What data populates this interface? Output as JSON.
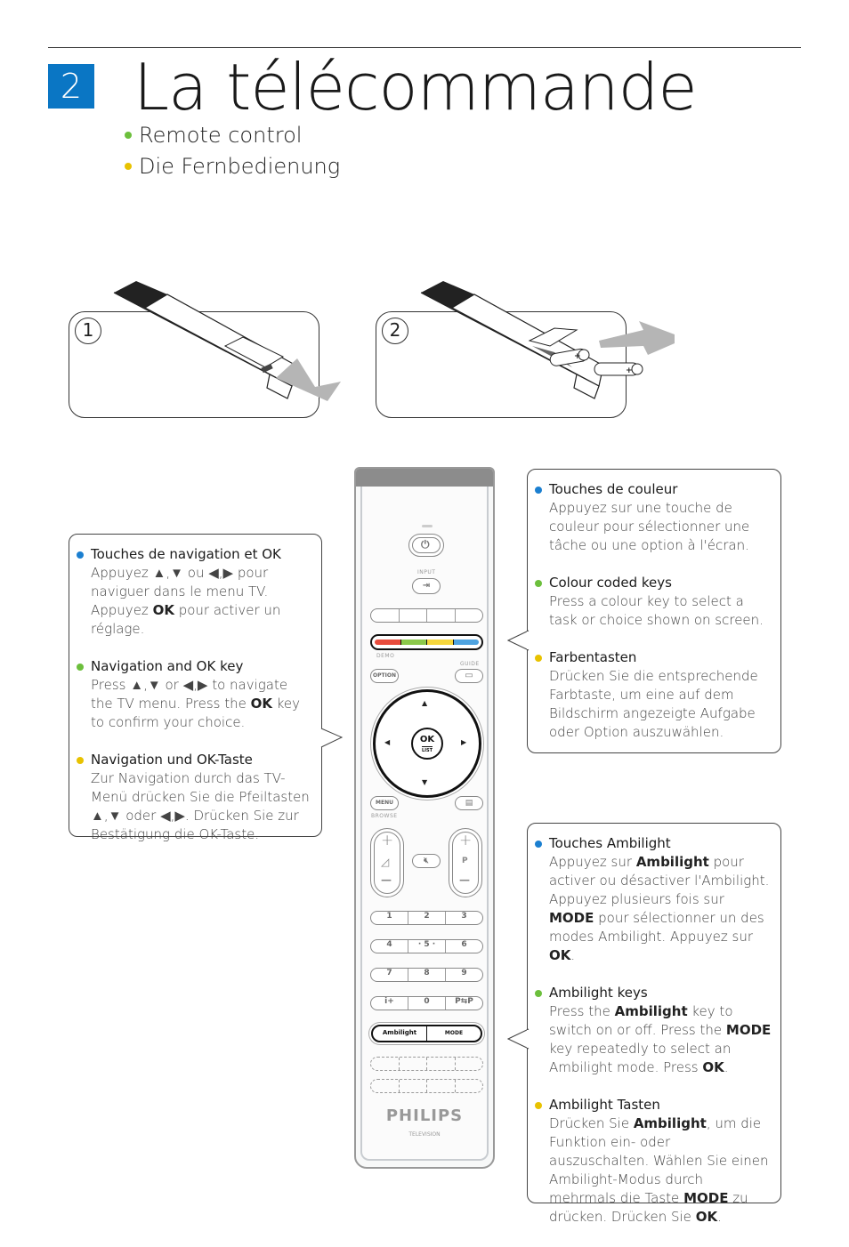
{
  "header": {
    "chapter_number": "2",
    "title": "La télécommande",
    "subtitles": [
      {
        "text": "Remote control",
        "bullet_color": "#6cbf3c"
      },
      {
        "text": "Die Fernbedienung",
        "bullet_color": "#e8c200"
      }
    ]
  },
  "battery_steps": [
    {
      "number": "1",
      "icon": "remote-cover-open-illustration"
    },
    {
      "number": "2",
      "icon": "insert-batteries-illustration"
    }
  ],
  "colors": {
    "accent_blue": "#0a76c4",
    "bullet_blue": "#1b7fd0",
    "bullet_green": "#6cbf3c",
    "bullet_yellow": "#e8c200",
    "key_red": "#e84c3d",
    "key_green": "#8cc84b",
    "key_yellow": "#f5d63d",
    "key_blue": "#4ea3e0"
  },
  "callouts": {
    "navigation": [
      {
        "bullet": "blue",
        "title": "Touches de navigation et OK",
        "body": "Appuyez ▲,▼ ou ◀,▶ pour naviguer dans le menu TV.  Appuyez OK pour activer un réglage."
      },
      {
        "bullet": "green",
        "title": "Navigation and OK key",
        "body": "Press ▲,▼ or ◀,▶ to navigate the TV menu. Press the OK key to confirm your choice."
      },
      {
        "bullet": "yellow",
        "title": "Navigation und OK-Taste",
        "body": "Zur Navigation durch das TV-Menü drücken Sie die Pfeiltasten ▲,▼ oder ◀,▶. Drücken Sie zur Bestätigung die OK-Taste."
      }
    ],
    "colour_keys": [
      {
        "bullet": "blue",
        "title": "Touches de couleur",
        "body": "Appuyez sur une touche de couleur pour sélectionner une tâche ou une option à l'écran."
      },
      {
        "bullet": "green",
        "title": "Colour coded keys",
        "body": "Press a colour key to select a task or choice shown on screen."
      },
      {
        "bullet": "yellow",
        "title": "Farbentasten",
        "body": "Drücken Sie die entsprechende Farbtaste, um eine auf dem Bildschirm angezeigte Aufgabe oder Option auszuwählen."
      }
    ],
    "ambilight": [
      {
        "bullet": "blue",
        "title": "Touches Ambilight",
        "body": "Appuyez sur Ambilight pour activer ou désactiver l'Ambilight. Appuyez plusieurs fois sur MODE pour sélectionner un des modes Ambilight. Appuyez sur OK."
      },
      {
        "bullet": "green",
        "title": "Ambilight keys",
        "body": "Press the Ambilight key to switch on or off. Press the MODE key repeatedly to select an Ambilight mode. Press OK."
      },
      {
        "bullet": "yellow",
        "title": "Ambilight Tasten",
        "body": "Drücken Sie Ambilight, um die Funktion ein- oder auszuschalten. Wählen Sie einen Ambilight-Modus durch mehrmals die Taste MODE zu drücken. Drücken Sie OK."
      }
    ]
  },
  "remote": {
    "input_label": "INPUT",
    "demo_label": "DEMO",
    "guide_label": "GUIDE",
    "option_label": "OPTION",
    "ok_label": "OK",
    "list_label": "LIST",
    "menu_label": "MENU",
    "browse_label": "BROWSE",
    "plus": "+",
    "minus": "—",
    "p_label": "P",
    "numpad": [
      [
        "1",
        "2",
        "3"
      ],
      [
        "4",
        "· 5 ·",
        "6"
      ],
      [
        "7",
        "8",
        "9"
      ],
      [
        "i+",
        "0",
        "P⇆P"
      ]
    ],
    "ambilight_label": "Ambilight",
    "mode_label": "MODE",
    "brand": "PHILIPS",
    "brand_sub": "TELEVISION",
    "arrows": {
      "up": "▲",
      "down": "▼",
      "left": "◀",
      "right": "▶"
    }
  }
}
